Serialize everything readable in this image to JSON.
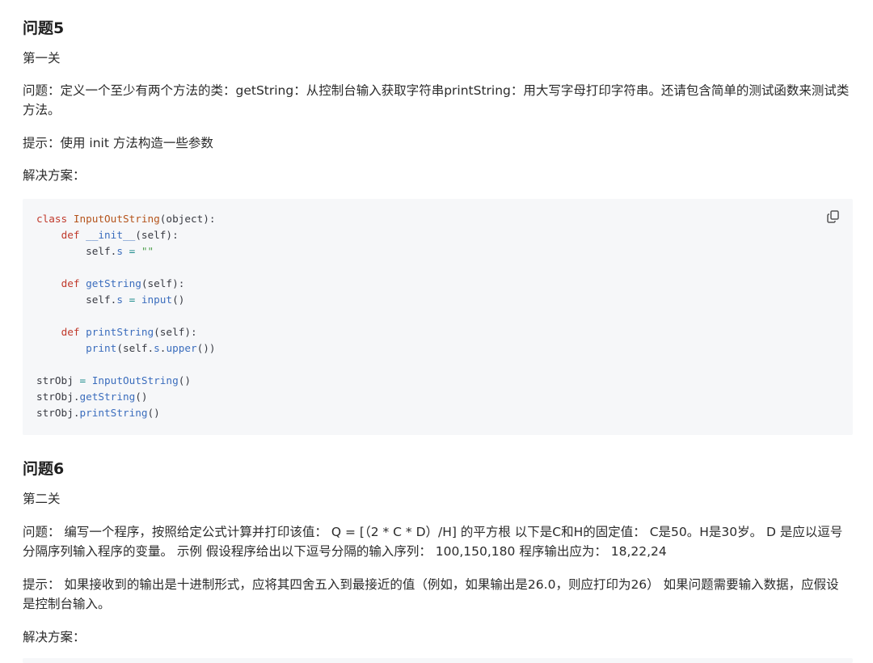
{
  "q5": {
    "title": "问题5",
    "level": "第一关",
    "question": "问题：定义一个至少有两个方法的类：getString：从控制台输入获取字符串printString：用大写字母打印字符串。还请包含简单的测试函数来测试类方法。",
    "hint": "提示：使用 init 方法构造一些参数",
    "solution_label": "解决方案：",
    "code_lines": [
      [
        [
          "kw",
          "class "
        ],
        [
          "cls",
          "InputOutString"
        ],
        [
          "pl",
          "(object):"
        ]
      ],
      [
        [
          "pl",
          "    "
        ],
        [
          "kw",
          "def "
        ],
        [
          "fn",
          "__init__"
        ],
        [
          "pl",
          "(self):"
        ]
      ],
      [
        [
          "pl",
          "        self."
        ],
        [
          "fn",
          "s"
        ],
        [
          "op",
          " = "
        ],
        [
          "str",
          "\"\""
        ]
      ],
      [],
      [
        [
          "pl",
          "    "
        ],
        [
          "kw",
          "def "
        ],
        [
          "fn",
          "getString"
        ],
        [
          "pl",
          "(self):"
        ]
      ],
      [
        [
          "pl",
          "        self."
        ],
        [
          "fn",
          "s"
        ],
        [
          "op",
          " = "
        ],
        [
          "fn",
          "input"
        ],
        [
          "pl",
          "()"
        ]
      ],
      [],
      [
        [
          "pl",
          "    "
        ],
        [
          "kw",
          "def "
        ],
        [
          "fn",
          "printString"
        ],
        [
          "pl",
          "(self):"
        ]
      ],
      [
        [
          "pl",
          "        "
        ],
        [
          "fn",
          "print"
        ],
        [
          "pl",
          "(self."
        ],
        [
          "fn",
          "s"
        ],
        [
          "pl",
          "."
        ],
        [
          "fn",
          "upper"
        ],
        [
          "pl",
          "())"
        ]
      ],
      [],
      [
        [
          "pl",
          "strObj"
        ],
        [
          "op",
          " = "
        ],
        [
          "fn",
          "InputOutString"
        ],
        [
          "pl",
          "()"
        ]
      ],
      [
        [
          "pl",
          "strObj."
        ],
        [
          "fn",
          "getString"
        ],
        [
          "pl",
          "()"
        ]
      ],
      [
        [
          "pl",
          "strObj."
        ],
        [
          "fn",
          "printString"
        ],
        [
          "pl",
          "()"
        ]
      ]
    ]
  },
  "q6": {
    "title": "问题6",
    "level": "第二关",
    "question": "问题： 编写一个程序，按照给定公式计算并打印该值： Q = [（2 * C * D）/H] 的平方根 以下是C和H的固定值： C是50。H是30岁。 D 是应以逗号分隔序列输入程序的变量。 示例 假设程序给出以下逗号分隔的输入序列： 100,150,180 程序输出应为： 18,22,24",
    "hint": "提示： 如果接收到的输出是十进制形式，应将其四舍五入到最接近的值（例如，如果输出是26.0，则应打印为26） 如果问题需要输入数据，应假设是控制台输入。",
    "solution_label": "解决方案："
  },
  "icons": {
    "copy": "copy-icon"
  }
}
